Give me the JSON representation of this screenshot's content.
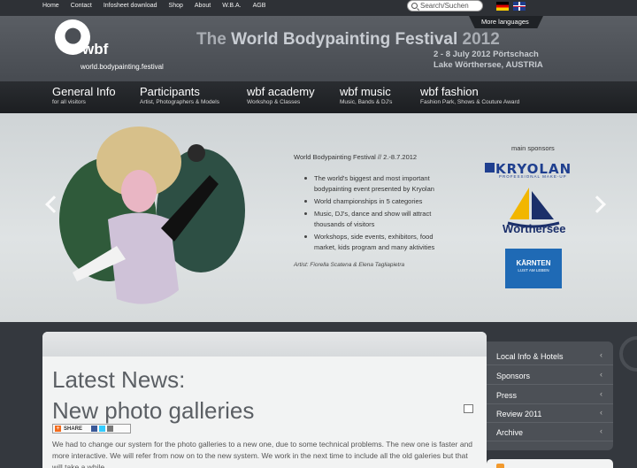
{
  "topnav": [
    "Home",
    "Contact",
    "Infosheet download",
    "Shop",
    "About",
    "W.B.A.",
    "AGB"
  ],
  "search": {
    "placeholder": "Search/Suchen"
  },
  "more_languages": "More languages",
  "logo": {
    "name": "wbf",
    "url": "world.bodypainting.festival"
  },
  "festival": {
    "title_pre": "The ",
    "title_main": "World Bodypainting Festival",
    "title_year": " 2012",
    "dates": "2 - 8 July 2012  Pörtschach",
    "place": "Lake Wörthersee, AUSTRIA"
  },
  "mainnav": [
    {
      "title": "General Info",
      "sub": "for all visitors"
    },
    {
      "title": "Participants",
      "sub": "Artist, Photographers & Models"
    },
    {
      "title": "wbf academy",
      "sub": "Workshop & Classes"
    },
    {
      "title": "wbf music",
      "sub": "Music, Bands & DJ's"
    },
    {
      "title": "wbf fashion",
      "sub": "Fashion Park, Shows & Couture Award"
    }
  ],
  "slide": {
    "title": "World Bodypainting Festival // 2.-8.7.2012",
    "bullets": [
      "The world's biggest and most important bodypainting event presented by Kryolan",
      "World championships in 5 categories",
      "Music, DJ's, dance and show will attract thousands of visitors",
      "Workshops, side events, exhibitors, food market, kids program and many aktivities"
    ],
    "artist": "Artist: Fiorella Scatena & Elena Tagliapietra"
  },
  "sponsors": {
    "heading": "main sponsors",
    "kryolan": "KRYOLAN",
    "kryolan_sub": "PROFESSIONAL MAKE-UP",
    "woerthersee": "Wörthersee",
    "kaernten": "KÄRNTEN",
    "kaernten_sub": "LUST AM LEBEN"
  },
  "news": {
    "heading": "Latest News:",
    "title": "New photo galleries",
    "share": "SHARE",
    "body": "We had to change our system for the photo galleries to a new one, due to some technical problems. The new one is faster and more interactive. We will refer from now on to the new system. We work in the next time to include all the old galeries but that will take a while."
  },
  "sidenav": [
    "Local Info & Hotels",
    "Sponsors",
    "Press",
    "Review 2011",
    "Archive"
  ],
  "colors": {
    "accent": "#1f3f8f",
    "nav_bg": "#1c1e21"
  }
}
